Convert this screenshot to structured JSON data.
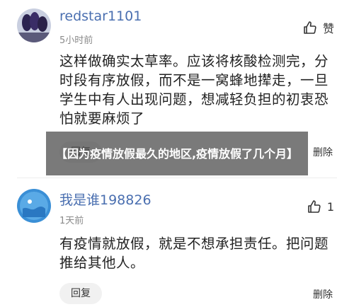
{
  "comments": [
    {
      "username": "redstar1101",
      "time": "5小时前",
      "like_label": "赞",
      "content": "这样做确实太草率。应该将核酸检测完，分时段有序放假，而不是一窝蜂地撵走，一旦学生中有人出现问题，想减轻负担的初衷恐怕就要麻烦了",
      "reply_label": "回复",
      "delete_label": "删除"
    },
    {
      "username": "我是谁198826",
      "time": "1天前",
      "like_label": "1",
      "content": "有疫情就放假，就是不想承担责任。把问题推给其他人。",
      "reply_label": "回复",
      "delete_label": "删除"
    }
  ],
  "overlay_title": "【因为疫情放假最久的地区,疫情放假了几个月】",
  "colors": {
    "username": "#4a6fb0",
    "meta": "#8a8a8a",
    "overlay_bg": "rgba(70,70,70,0.72)"
  },
  "icons": {
    "like": "thumbs-up-icon"
  }
}
